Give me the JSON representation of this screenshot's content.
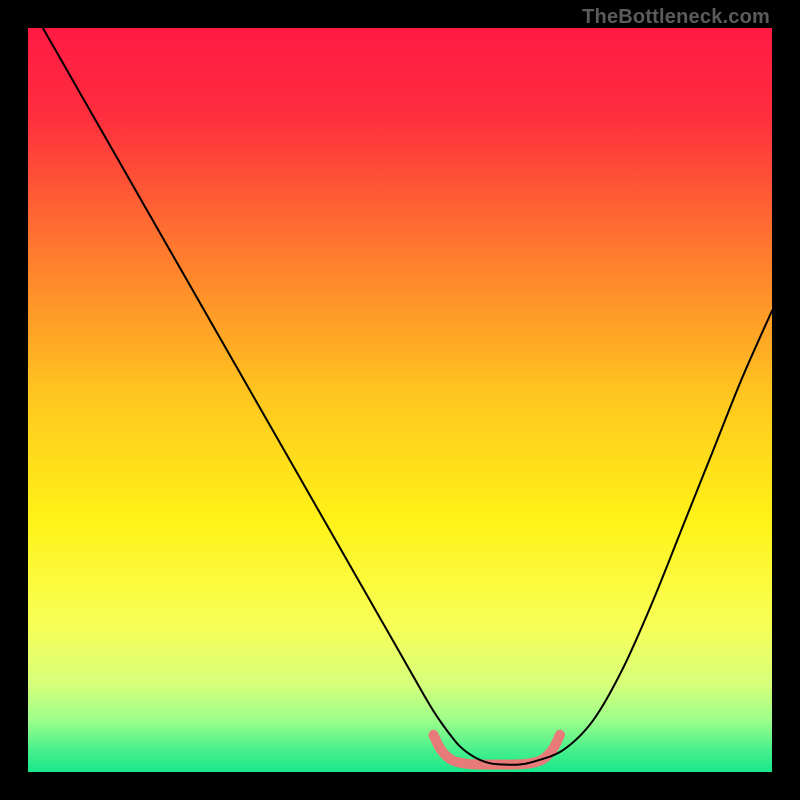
{
  "watermark": "TheBottleneck.com",
  "chart_data": {
    "type": "line",
    "title": "",
    "xlabel": "",
    "ylabel": "",
    "xlim": [
      0,
      100
    ],
    "ylim": [
      0,
      100
    ],
    "grid": false,
    "legend": false,
    "background": {
      "type": "vertical-gradient",
      "stops": [
        {
          "pos": 0.0,
          "color": "#ff1a44"
        },
        {
          "pos": 0.12,
          "color": "#ff2e3e"
        },
        {
          "pos": 0.3,
          "color": "#ff7a2e"
        },
        {
          "pos": 0.5,
          "color": "#ffc81f"
        },
        {
          "pos": 0.66,
          "color": "#fff217"
        },
        {
          "pos": 0.8,
          "color": "#f8ff55"
        },
        {
          "pos": 0.88,
          "color": "#d8ff7a"
        },
        {
          "pos": 0.93,
          "color": "#9dff8a"
        },
        {
          "pos": 0.97,
          "color": "#49f08c"
        },
        {
          "pos": 1.0,
          "color": "#19e88c"
        }
      ]
    },
    "series": [
      {
        "name": "curve",
        "color": "#000000",
        "width": 2,
        "x": [
          2,
          6,
          10,
          14,
          18,
          22,
          26,
          30,
          34,
          38,
          42,
          46,
          50,
          54,
          56,
          58,
          60,
          62,
          64,
          66,
          68,
          72,
          76,
          80,
          84,
          88,
          92,
          96,
          100
        ],
        "y": [
          100,
          93,
          86,
          79,
          72,
          65,
          58,
          51,
          44,
          37,
          30,
          23,
          16,
          9,
          6,
          3.5,
          2,
          1.2,
          1,
          1,
          1.4,
          3,
          7,
          14,
          23,
          33,
          43,
          53,
          62
        ]
      },
      {
        "name": "optimal-zone",
        "color": "#e97a7a",
        "width": 10,
        "linecap": "round",
        "x": [
          54.5,
          55.5,
          57,
          59,
          61,
          63,
          65,
          67,
          69,
          70.5,
          71.5
        ],
        "y": [
          5.0,
          3.0,
          1.6,
          1.1,
          1.0,
          1.0,
          1.0,
          1.1,
          1.6,
          3.0,
          5.0
        ]
      }
    ]
  }
}
